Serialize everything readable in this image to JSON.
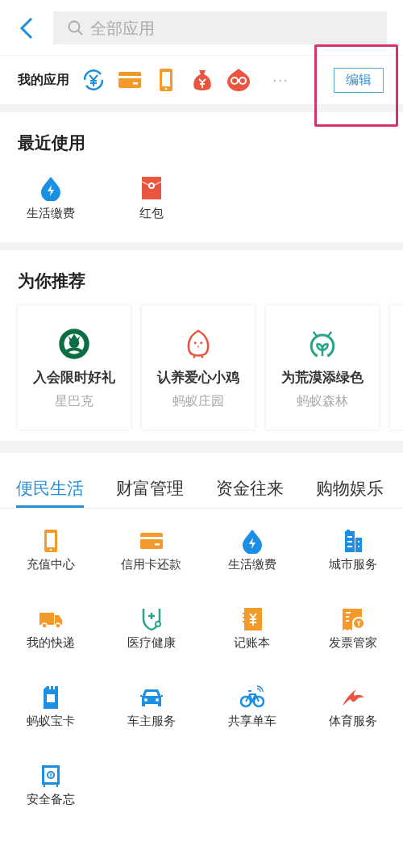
{
  "search": {
    "placeholder": "全部应用"
  },
  "my_apps": {
    "label": "我的应用",
    "more": "···",
    "edit_button": "编辑",
    "highlighted": true
  },
  "recent": {
    "title": "最近使用",
    "items": [
      {
        "label": "生活缴费"
      },
      {
        "label": "红包"
      }
    ]
  },
  "recommend": {
    "title": "为你推荐",
    "cards": [
      {
        "title": "入会限时好礼",
        "subtitle": "星巴克"
      },
      {
        "title": "认养爱心小鸡",
        "subtitle": "蚂蚁庄园"
      },
      {
        "title": "为荒漠添绿色",
        "subtitle": "蚂蚁森林"
      }
    ]
  },
  "tabs": [
    {
      "label": "便民生活",
      "selected": true
    },
    {
      "label": "财富管理",
      "selected": false
    },
    {
      "label": "资金往来",
      "selected": false
    },
    {
      "label": "购物娱乐",
      "selected": false
    }
  ],
  "apps": [
    {
      "label": "充值中心"
    },
    {
      "label": "信用卡还款"
    },
    {
      "label": "生活缴费"
    },
    {
      "label": "城市服务"
    },
    {
      "label": "我的快递"
    },
    {
      "label": "医疗健康"
    },
    {
      "label": "记账本"
    },
    {
      "label": "发票管家"
    },
    {
      "label": "蚂蚁宝卡"
    },
    {
      "label": "车主服务"
    },
    {
      "label": "共享单车"
    },
    {
      "label": "体育服务"
    },
    {
      "label": "安全备忘"
    }
  ]
}
